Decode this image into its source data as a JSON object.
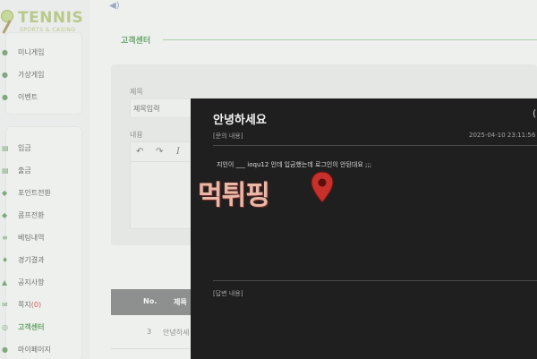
{
  "brand": {
    "name": "TENNIS",
    "tagline": "SPORTS & CASINO"
  },
  "sidebar": {
    "top_items": [
      {
        "label": "미니게임",
        "icon": "dice-icon"
      },
      {
        "label": "가상게임",
        "icon": "gamepad-icon"
      },
      {
        "label": "이벤트",
        "icon": "gift-icon"
      }
    ],
    "items": [
      {
        "label": "입금",
        "icon": "deposit-icon"
      },
      {
        "label": "출금",
        "icon": "withdraw-icon"
      },
      {
        "label": "포인트전환",
        "icon": "points-icon"
      },
      {
        "label": "콤프전환",
        "icon": "comp-icon"
      },
      {
        "label": "베팅내역",
        "icon": "list-icon"
      },
      {
        "label": "경기결과",
        "icon": "trophy-icon"
      },
      {
        "label": "공지사항",
        "icon": "notice-icon"
      },
      {
        "label": "쪽지",
        "count": "(0)",
        "icon": "mail-icon"
      },
      {
        "label": "고객센터",
        "icon": "support-icon",
        "active": true
      },
      {
        "label": "마이페이지",
        "icon": "user-icon"
      }
    ]
  },
  "main": {
    "section_title": "고객센터",
    "form": {
      "title_label": "제목",
      "title_placeholder": "제목입력",
      "content_label": "내용",
      "toolbar": {
        "undo": "↶",
        "redo": "↷",
        "italic": "I"
      }
    },
    "table": {
      "headers": {
        "no": "No.",
        "title": "제목"
      },
      "rows": [
        {
          "no": "3",
          "title": "안녕하세"
        }
      ]
    }
  },
  "modal": {
    "title": "안녕하세요",
    "inquiry_label": "[문의 내용]",
    "inquiry_date": "2025-04-10 23:11:56",
    "inquiry_body": "지인이 ___ ioqu12 인데 입금했는데 로그인이 안된대요 ;;;",
    "answer_label": "[답변 내용]",
    "close_glyph": "(",
    "close_icon": "close-icon"
  },
  "watermark": {
    "text": "먹튀핑",
    "pin_color": "#c8312b"
  },
  "colors": {
    "accent_green": "#6aa46a",
    "modal_bg": "#1f1f1f",
    "table_head": "#8e908f"
  }
}
